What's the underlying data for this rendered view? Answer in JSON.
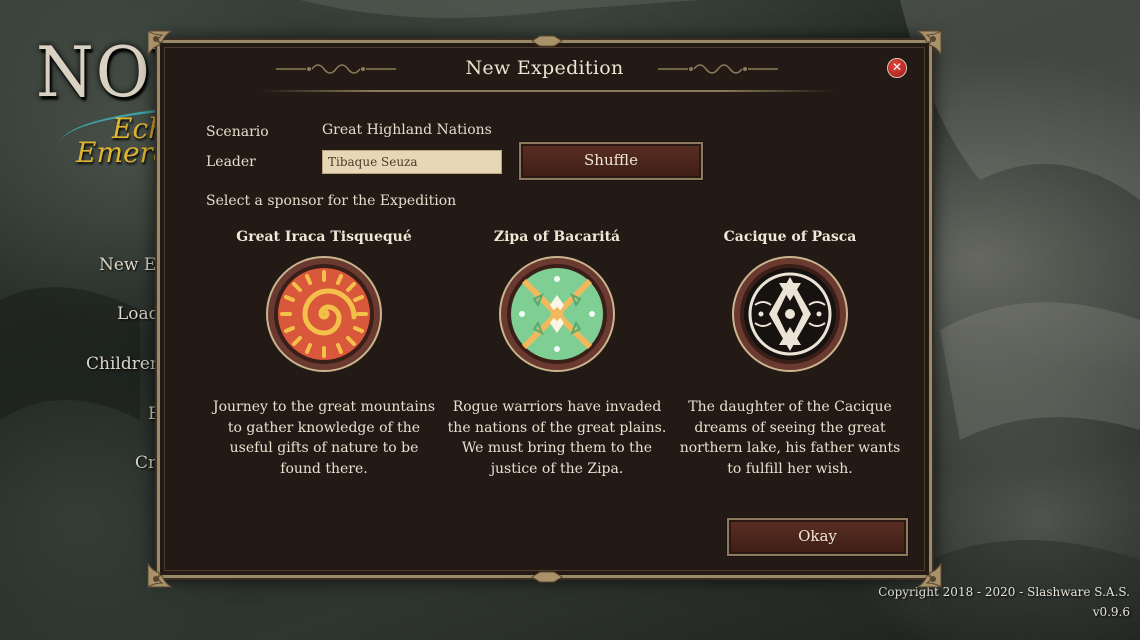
{
  "background": {
    "logo": {
      "title": "NOVA",
      "subtitle_line1": "Ech",
      "subtitle_line2": "Emeral"
    },
    "menu_items": [
      "New Ex",
      "Load",
      "Children",
      "E",
      "Cre"
    ],
    "copyright": "Copyright 2018 - 2020 - Slashware S.A.S.",
    "version": "v0.9.6"
  },
  "dialog": {
    "title": "New Expedition",
    "close_icon": "close-icon",
    "scenario_label": "Scenario",
    "scenario_value": "Great Highland Nations",
    "leader_label": "Leader",
    "leader_value": "Tibaque Seuza",
    "shuffle_label": "Shuffle",
    "sponsor_prompt": "Select a sponsor for the Expedition",
    "sponsors": [
      {
        "name": "Great Iraca Tisquequé",
        "emblem": "sun-spiral-emblem",
        "description": "Journey to the great mountains to gather knowledge of the useful gifts of nature to be found there."
      },
      {
        "name": "Zipa of Bacaritá",
        "emblem": "green-cross-pattern-emblem",
        "description": "Rogue warriors have invaded the nations of the great plains. We must bring them to the justice of the Zipa."
      },
      {
        "name": "Cacique of Pasca",
        "emblem": "black-white-geometric-emblem",
        "description": "The daughter of the Cacique dreams of seeing the great northern lake, his father wants to fulfill her wish."
      }
    ],
    "okay_label": "Okay"
  },
  "colors": {
    "dialog_bg": "#231a15",
    "frame_gold": "#9a8a6a",
    "button_maroon": "#4a241b",
    "logo_gold": "#e0b430",
    "close_red": "#c2302a"
  }
}
